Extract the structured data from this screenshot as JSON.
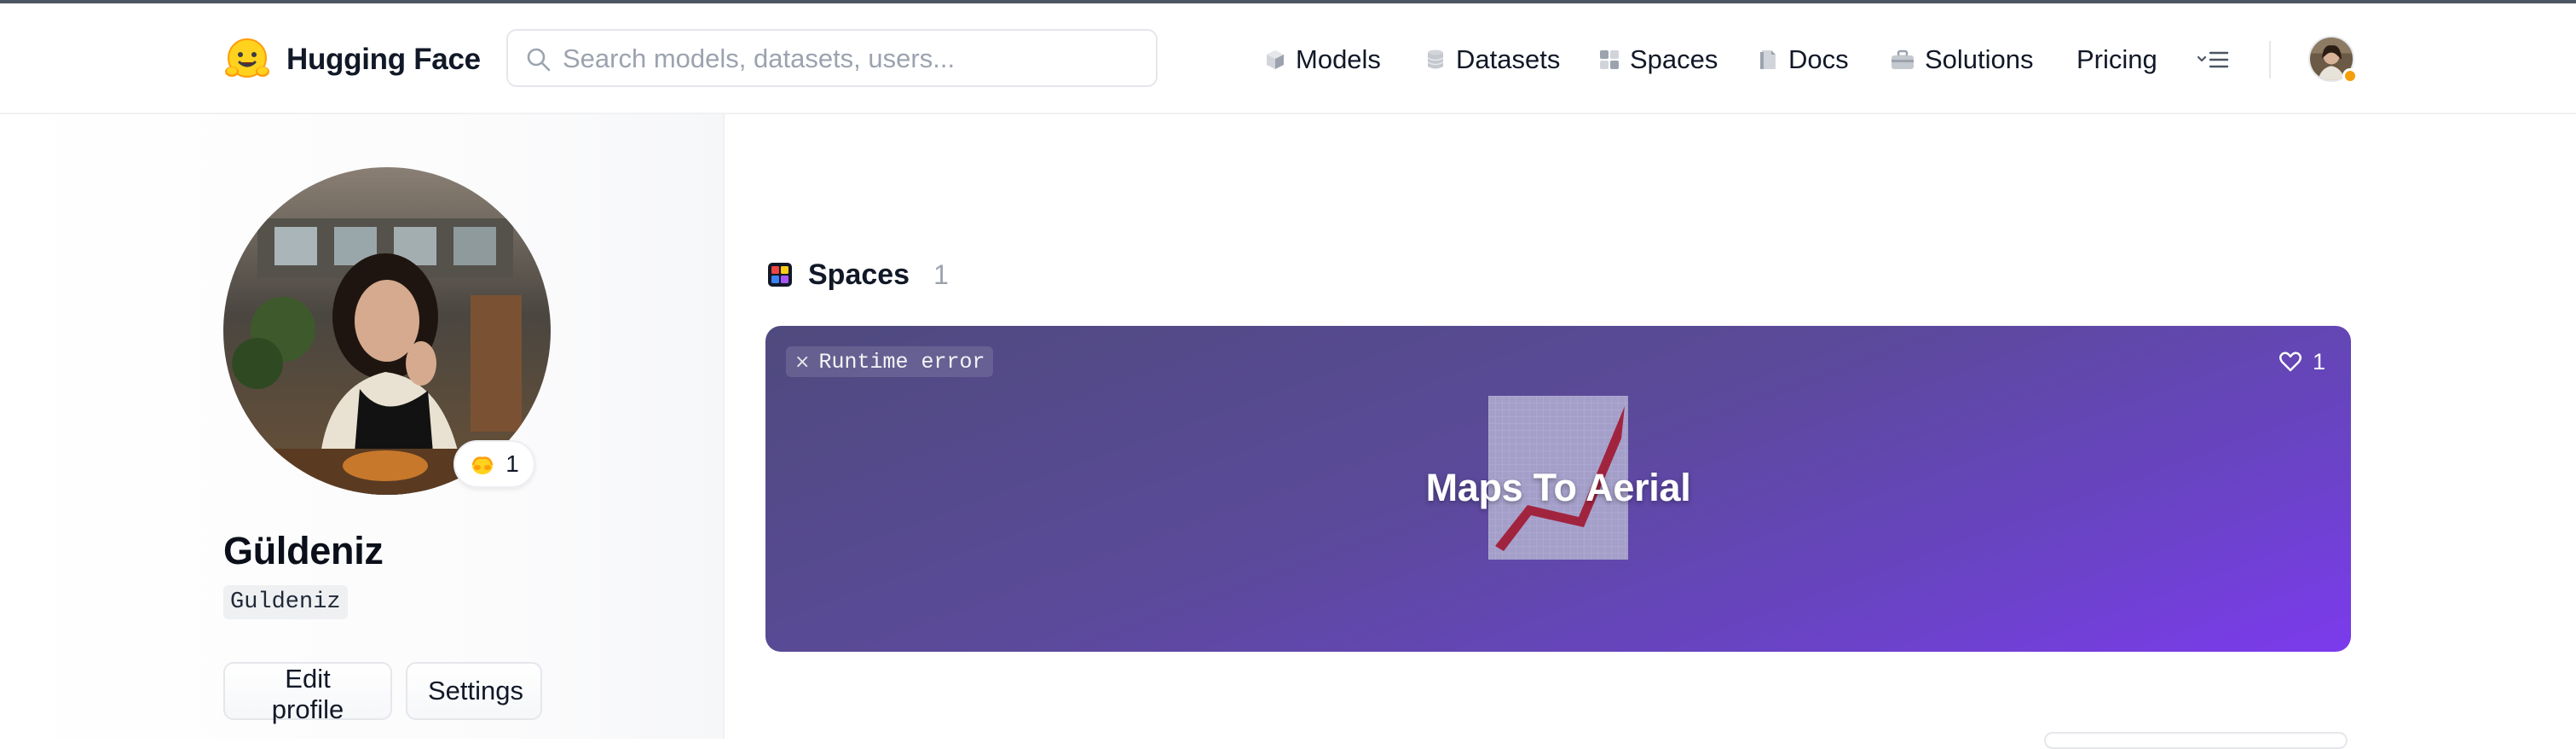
{
  "header": {
    "brand": "Hugging Face",
    "search": {
      "placeholder": "Search models, datasets, users...",
      "value": ""
    },
    "nav": [
      {
        "label": "Models",
        "icon": "models-icon"
      },
      {
        "label": "Datasets",
        "icon": "datasets-icon"
      },
      {
        "label": "Spaces",
        "icon": "spaces-icon"
      },
      {
        "label": "Docs",
        "icon": "docs-icon"
      },
      {
        "label": "Solutions",
        "icon": "solutions-icon"
      },
      {
        "label": "Pricing"
      }
    ],
    "more_icon": "menu-more-icon",
    "status_color": "#f59e0b"
  },
  "profile": {
    "fullname": "Güldeniz",
    "username": "Guldeniz",
    "likes": "1",
    "buttons": {
      "edit": "Edit profile",
      "settings": "Settings"
    }
  },
  "spaces": {
    "title": "Spaces",
    "count": "1",
    "items": [
      {
        "status": "Runtime error",
        "likes": "1",
        "title": "Maps To Aerial",
        "gradient": [
          "#4f4a7e",
          "#7c3aed"
        ]
      }
    ]
  }
}
